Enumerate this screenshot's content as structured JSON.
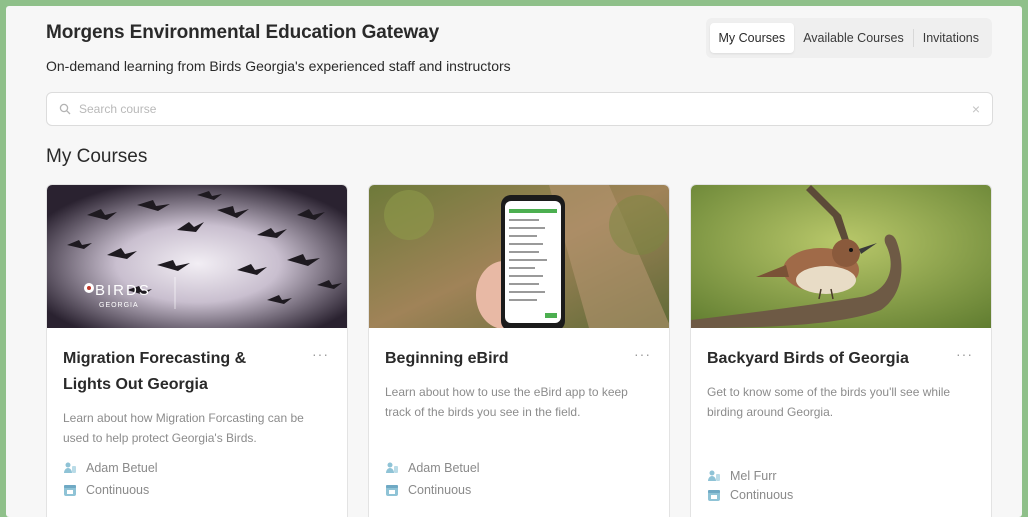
{
  "header": {
    "title": "Morgens Environmental Education Gateway",
    "subtitle": "On-demand learning from Birds Georgia's experienced staff and instructors"
  },
  "tabs": [
    {
      "label": "My Courses",
      "active": true
    },
    {
      "label": "Available Courses",
      "active": false
    },
    {
      "label": "Invitations",
      "active": false
    }
  ],
  "search": {
    "placeholder": "Search course",
    "value": ""
  },
  "section": {
    "title": "My Courses"
  },
  "courses": [
    {
      "title": "Migration Forecasting & Lights Out Georgia",
      "description": "Learn about how Migration Forcasting can be used to help protect Georgia's Birds.",
      "instructor": "Adam Betuel",
      "schedule": "Continuous",
      "thumb_logo": "BIRDS",
      "thumb_logo_sub": "GEORGIA"
    },
    {
      "title": "Beginning eBird",
      "description": "Learn about how to use the eBird app to keep track of the birds you see in the field.",
      "instructor": "Adam Betuel",
      "schedule": "Continuous"
    },
    {
      "title": "Backyard Birds of Georgia",
      "description": "Get to know some of the birds you'll see while birding around Georgia.",
      "instructor": "Mel Furr",
      "schedule": "Continuous"
    }
  ],
  "colors": {
    "background": "#8fc08a",
    "accent": "#6fa9c4"
  }
}
